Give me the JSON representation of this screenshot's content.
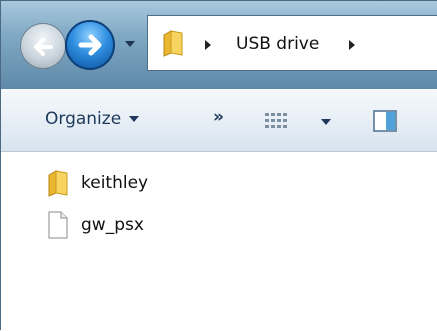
{
  "address": {
    "path": [
      "USB drive"
    ]
  },
  "toolbar": {
    "organize_label": "Organize",
    "more_label": "»"
  },
  "files": [
    {
      "name": "keithley",
      "icon": "folder-icon"
    },
    {
      "name": "gw_psx",
      "icon": "file-icon"
    }
  ],
  "colors": {
    "titlebar": "#7fa8c4",
    "toolbar_text": "#1e395b",
    "forward_button": "#2f8ee0"
  }
}
